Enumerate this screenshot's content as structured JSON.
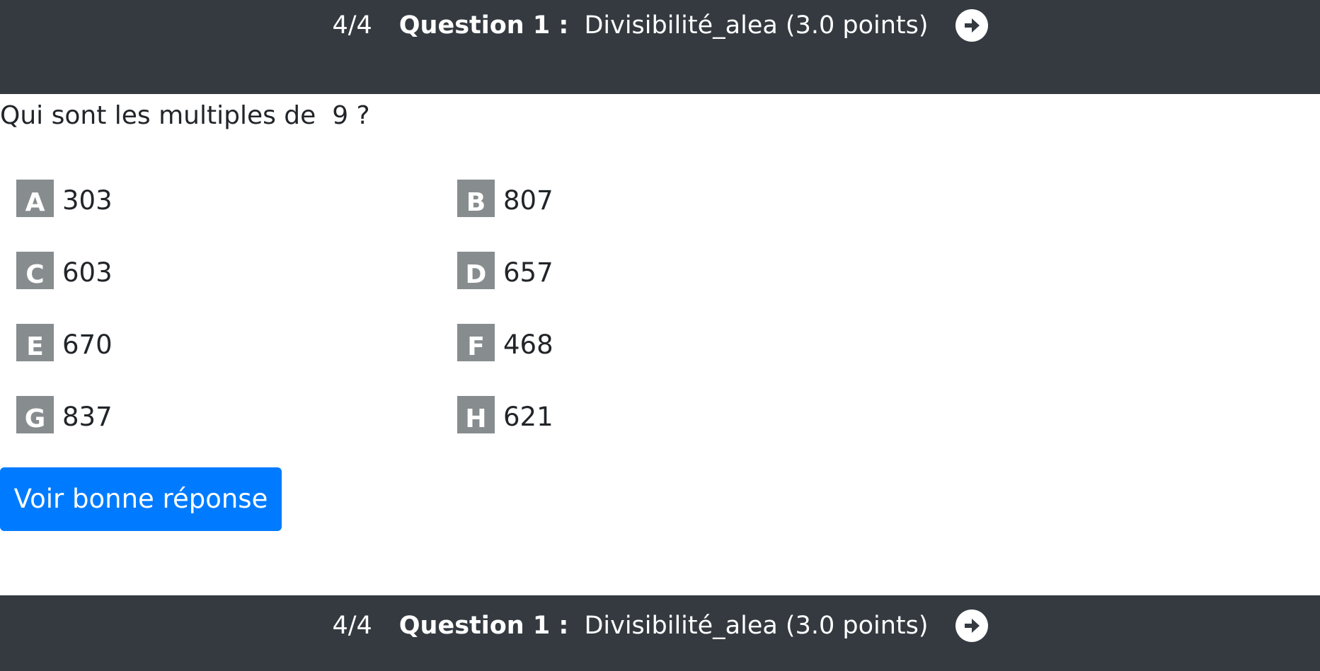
{
  "header": {
    "progress": "4/4",
    "question_number": "Question 1 :",
    "question_title": "Divisibilité_alea (3.0 points)",
    "next_icon": "arrow-right-circle-icon"
  },
  "question": {
    "prompt": "Qui sont les multiples de  9 ?"
  },
  "answers": [
    {
      "letter": "A",
      "value": "303"
    },
    {
      "letter": "B",
      "value": "807"
    },
    {
      "letter": "C",
      "value": "603"
    },
    {
      "letter": "D",
      "value": "657"
    },
    {
      "letter": "E",
      "value": "670"
    },
    {
      "letter": "F",
      "value": "468"
    },
    {
      "letter": "G",
      "value": "837"
    },
    {
      "letter": "H",
      "value": "621"
    }
  ],
  "actions": {
    "see_answer_label": "Voir bonne réponse"
  },
  "footer": {
    "progress": "4/4",
    "question_number": "Question 1 :",
    "question_title": "Divisibilité_alea (3.0 points)",
    "next_icon": "arrow-right-circle-icon"
  },
  "colors": {
    "bar_background": "#343a40",
    "letter_badge": "#878d8e",
    "primary_button": "#007bff"
  }
}
